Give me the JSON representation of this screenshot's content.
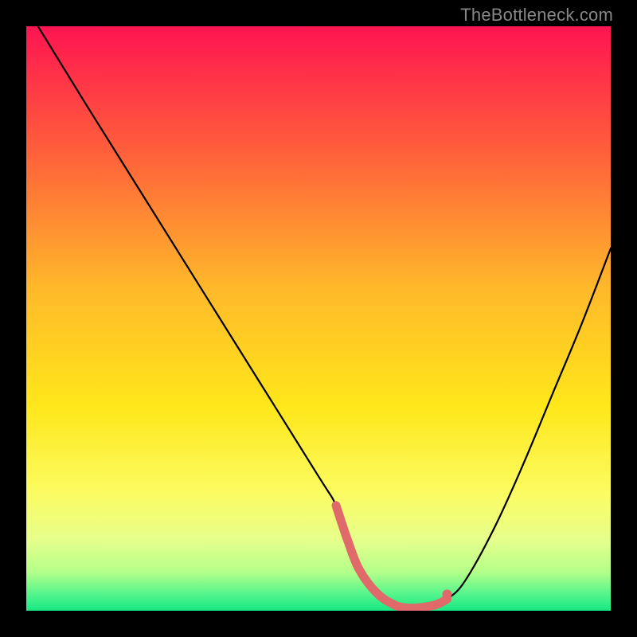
{
  "watermark": "TheBottleneck.com",
  "chart_data": {
    "type": "line",
    "title": "",
    "xlabel": "",
    "ylabel": "",
    "xlim": [
      0,
      100
    ],
    "ylim": [
      0,
      100
    ],
    "series": [
      {
        "name": "bottleneck-curve",
        "x": [
          2,
          10,
          20,
          30,
          40,
          50,
          53,
          55,
          57,
          60,
          63,
          65,
          67,
          70,
          72,
          75,
          80,
          85,
          90,
          95,
          100
        ],
        "y": [
          100,
          87,
          71,
          55,
          39,
          23,
          18,
          12,
          7,
          3,
          1,
          0.5,
          0.5,
          1,
          2,
          5,
          14,
          25,
          37,
          49,
          62
        ]
      }
    ],
    "highlight_range_x": [
      53,
      72
    ],
    "gradient_stops": [
      {
        "offset": 0,
        "color": "#ff1451"
      },
      {
        "offset": 0.2,
        "color": "#ff5a3c"
      },
      {
        "offset": 0.45,
        "color": "#ffb92a"
      },
      {
        "offset": 0.65,
        "color": "#ffe71a"
      },
      {
        "offset": 0.8,
        "color": "#fbfc63"
      },
      {
        "offset": 0.88,
        "color": "#e6ff8c"
      },
      {
        "offset": 0.935,
        "color": "#b2ff8a"
      },
      {
        "offset": 0.97,
        "color": "#58f58c"
      },
      {
        "offset": 1.0,
        "color": "#17e884"
      }
    ],
    "curve_color": "#000000",
    "highlight_color": "#e06a6a"
  }
}
